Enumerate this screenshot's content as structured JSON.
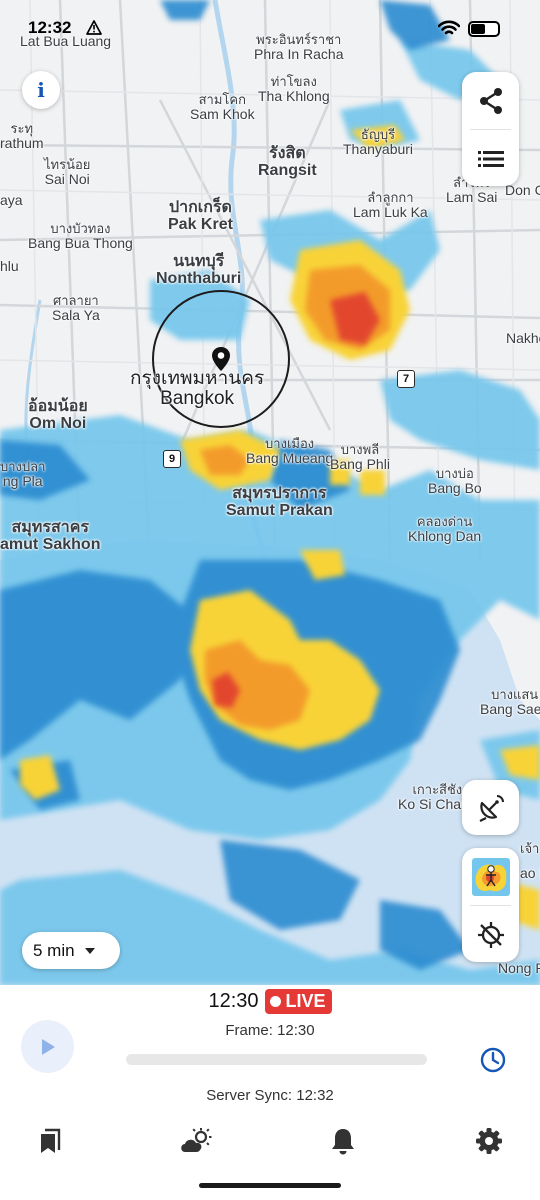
{
  "status_bar": {
    "time": "12:32",
    "warning_icon": "warning-triangle-icon",
    "wifi_icon": "wifi-icon",
    "battery_icon": "battery-icon"
  },
  "map": {
    "labels": [
      {
        "id": "lat-bua-luang",
        "th": "",
        "en": "Lat Bua Luang"
      },
      {
        "id": "phra-in-racha",
        "th": "พระอินทร์ราชา",
        "en": "Phra In Racha"
      },
      {
        "id": "tha-khlong",
        "th": "ท่าโขลง",
        "en": "Tha Khlong"
      },
      {
        "id": "sam-khok",
        "th": "สามโคก",
        "en": "Sam Khok"
      },
      {
        "id": "thanyaburi",
        "th": "ธัญบุรี",
        "en": "Thanyaburi"
      },
      {
        "id": "pathum-thani",
        "th": "ระทุ",
        "en": "rathum"
      },
      {
        "id": "don-ch",
        "th": "",
        "en": "Don Ch"
      },
      {
        "id": "sai-noi",
        "th": "ไทรน้อย",
        "en": "Sai Noi"
      },
      {
        "id": "rangsit",
        "th": "รังสิต",
        "en": "Rangsit"
      },
      {
        "id": "lam-sai",
        "th": "ลำไทร",
        "en": "Lam Sai"
      },
      {
        "id": "aya",
        "th": "",
        "en": "aya"
      },
      {
        "id": "lam-luk-ka",
        "th": "ลำลูกกา",
        "en": "Lam Luk Ka"
      },
      {
        "id": "pak-kret",
        "th": "ปากเกร็ด",
        "en": "Pak Kret"
      },
      {
        "id": "bang-bua-thong",
        "th": "บางบัวทอง",
        "en": "Bang Bua Thong"
      },
      {
        "id": "hlu",
        "th": "",
        "en": "hlu"
      },
      {
        "id": "nonthaburi",
        "th": "นนทบุรี",
        "en": "Nonthaburi"
      },
      {
        "id": "sala-ya",
        "th": "ศาลายา",
        "en": "Sala Ya"
      },
      {
        "id": "nakho",
        "th": "",
        "en": "Nakho"
      },
      {
        "id": "bangkok",
        "th": "กรุงเทพมหานคร",
        "en": "Bangkok"
      },
      {
        "id": "om-noi",
        "th": "อ้อมน้อย",
        "en": "Om Noi"
      },
      {
        "id": "bang-mueang",
        "th": "บางเมือง",
        "en": "Bang Mueang"
      },
      {
        "id": "bang-phli",
        "th": "บางพลี",
        "en": "Bang Phli"
      },
      {
        "id": "bang-pla",
        "th": "บางปลา",
        "en": "ng Pla"
      },
      {
        "id": "bang-bo",
        "th": "บางบ่อ",
        "en": "Bang Bo"
      },
      {
        "id": "samut-prakan",
        "th": "สมุทรปราการ",
        "en": "Samut Prakan"
      },
      {
        "id": "khlong-dan",
        "th": "คลองด่าน",
        "en": "Khlong Dan"
      },
      {
        "id": "samut-sakhon",
        "th": "สมุทรสาคร",
        "en": "amut Sakhon"
      },
      {
        "id": "bang-saen",
        "th": "บางแสน",
        "en": "Bang Saen"
      },
      {
        "id": "ko-si-chang",
        "th": "เกาะสีชัง",
        "en": "Ko Si Chang"
      },
      {
        "id": "nong-p",
        "th": "",
        "en": "Nong P"
      },
      {
        "id": "rao-p",
        "th": "",
        "en": "ao P"
      },
      {
        "id": "chao",
        "th": "เจ้า",
        "en": ""
      }
    ],
    "route_shields": [
      "7",
      "9"
    ],
    "location_pin_icon": "location-pin-icon"
  },
  "controls": {
    "info_label": "i",
    "share_icon": "share-icon",
    "list_icon": "layers-list-icon",
    "satellite_icon": "satellite-dish-icon",
    "radar_thumbnail_icon": "radar-thumbnail-icon",
    "locate_icon": "location-off-icon",
    "interval_value": "5 min"
  },
  "timeline": {
    "current_time": "12:30",
    "live_label": "LIVE",
    "frame_label": "Frame: 12:30",
    "server_sync_label": "Server Sync: 12:32",
    "play_icon": "play-icon",
    "history_icon": "clock-icon",
    "progress": 0
  },
  "tabs": [
    {
      "name": "bookmarks",
      "icon": "bookmarks-icon"
    },
    {
      "name": "weather",
      "icon": "cloud-sun-icon"
    },
    {
      "name": "alerts",
      "icon": "bell-icon"
    },
    {
      "name": "settings",
      "icon": "gear-icon"
    }
  ],
  "colors": {
    "accent": "#1457b8",
    "live_red": "#e53935",
    "radar_light_blue": "#74c6ec",
    "radar_blue": "#2b8bd0",
    "radar_yellow": "#f8d337",
    "radar_orange": "#f39b2c",
    "radar_red": "#e2462f"
  }
}
